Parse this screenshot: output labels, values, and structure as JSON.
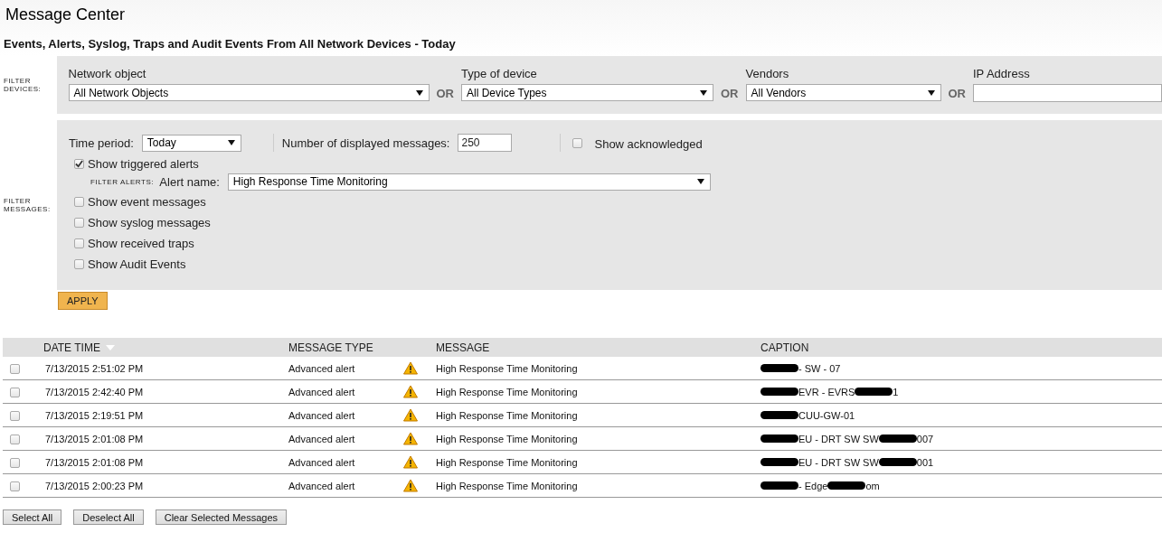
{
  "page": {
    "title": "Message Center",
    "subtitle": "Events, Alerts, Syslog, Traps and Audit Events From All Network Devices - Today"
  },
  "filter_devices": {
    "label": "FILTER DEVICES:",
    "fields": [
      {
        "kind": "dropdown",
        "label": "Network object",
        "value": "All Network Objects",
        "joiner": "OR"
      },
      {
        "kind": "dropdown",
        "label": "Type of device",
        "value": "All Device Types",
        "joiner": "OR"
      },
      {
        "kind": "dropdown",
        "label": "Vendors",
        "value": "All Vendors",
        "joiner": "OR"
      },
      {
        "kind": "input",
        "label": "IP Address"
      }
    ]
  },
  "filter_messages": {
    "label": "FILTER MESSAGES:",
    "time_period": {
      "label": "Time period:",
      "value": "Today"
    },
    "displayed": {
      "label": "Number of displayed messages:",
      "value": "250"
    },
    "show_acknowledged": {
      "label": "Show acknowledged",
      "checked": false
    },
    "triggered_alerts": {
      "label": "Show triggered alerts",
      "checked": true
    },
    "filter_alerts": {
      "label": "FILTER ALERTS:",
      "alert_label": "Alert name:",
      "value": "High Response Time Monitoring"
    },
    "options": [
      {
        "label": "Show event messages",
        "checked": false
      },
      {
        "label": "Show syslog messages",
        "checked": false
      },
      {
        "label": "Show received traps",
        "checked": false
      },
      {
        "label": "Show Audit Events",
        "checked": false
      }
    ],
    "apply": "APPLY"
  },
  "table": {
    "columns": [
      {
        "label": "DATE TIME",
        "sorted": true
      },
      {
        "label": "MESSAGE TYPE",
        "sorted": false
      },
      {
        "label": "MESSAGE",
        "sorted": false
      },
      {
        "label": "CAPTION",
        "sorted": false
      }
    ],
    "rows": [
      {
        "checked": false,
        "date_time": "7/13/2015 2:51:02 PM",
        "type": "Advanced alert",
        "message": "High Response Time Monitoring",
        "caption": [
          {
            "kind": "redacted"
          },
          {
            "kind": "text",
            "text": "- SW - 07"
          }
        ]
      },
      {
        "checked": false,
        "date_time": "7/13/2015 2:42:40 PM",
        "type": "Advanced alert",
        "message": "High Response Time Monitoring",
        "caption": [
          {
            "kind": "redacted"
          },
          {
            "kind": "text",
            "text": "EVR - EVRS"
          },
          {
            "kind": "redacted"
          },
          {
            "kind": "text",
            "text": "1"
          }
        ]
      },
      {
        "checked": false,
        "date_time": "7/13/2015 2:19:51 PM",
        "type": "Advanced alert",
        "message": "High Response Time Monitoring",
        "caption": [
          {
            "kind": "redacted"
          },
          {
            "kind": "text",
            "text": "CUU-GW-01"
          }
        ]
      },
      {
        "checked": false,
        "date_time": "7/13/2015 2:01:08 PM",
        "type": "Advanced alert",
        "message": "High Response Time Monitoring",
        "caption": [
          {
            "kind": "redacted"
          },
          {
            "kind": "text",
            "text": "EU - DRT SW SW"
          },
          {
            "kind": "redacted"
          },
          {
            "kind": "text",
            "text": "007"
          }
        ]
      },
      {
        "checked": false,
        "date_time": "7/13/2015 2:01:08 PM",
        "type": "Advanced alert",
        "message": "High Response Time Monitoring",
        "caption": [
          {
            "kind": "redacted"
          },
          {
            "kind": "text",
            "text": "EU - DRT SW SW"
          },
          {
            "kind": "redacted"
          },
          {
            "kind": "text",
            "text": "001"
          }
        ]
      },
      {
        "checked": false,
        "date_time": "7/13/2015 2:00:23 PM",
        "type": "Advanced alert",
        "message": "High Response Time Monitoring",
        "caption": [
          {
            "kind": "redacted"
          },
          {
            "kind": "text",
            "text": "- Edge"
          },
          {
            "kind": "redacted"
          },
          {
            "kind": "text",
            "text": "om"
          }
        ]
      }
    ]
  },
  "actions": [
    "Select All",
    "Deselect All",
    "Clear Selected Messages"
  ]
}
